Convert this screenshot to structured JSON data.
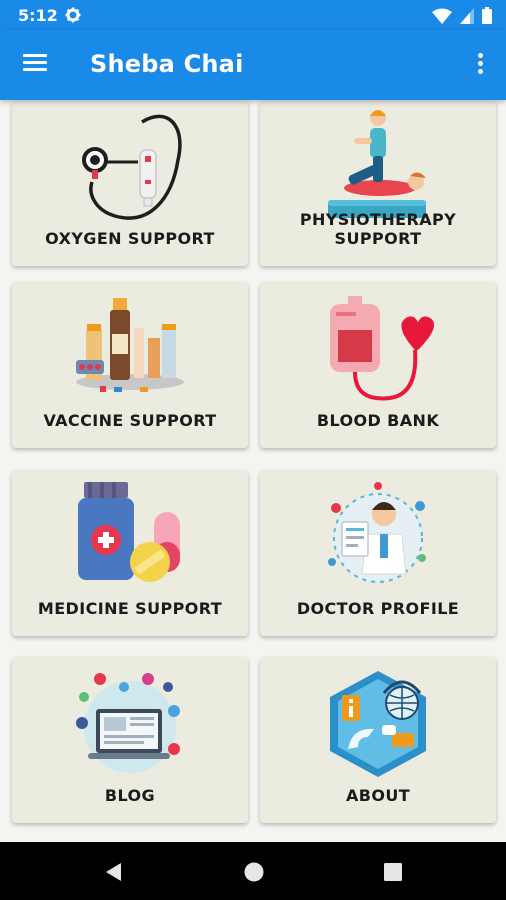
{
  "status_bar": {
    "time": "5:12",
    "icons": [
      "settings-gear-icon",
      "wifi-icon",
      "cellular-signal-icon",
      "battery-icon"
    ]
  },
  "app_bar": {
    "title": "Sheba Chai",
    "icons": [
      "hamburger-menu-icon",
      "more-vertical-icon"
    ],
    "color": "#1a8ae8"
  },
  "grid": {
    "cards": [
      {
        "label": "OXYGEN SUPPORT",
        "icon": "oxygen-mask-icon"
      },
      {
        "label": "PHYSIOTHERAPY SUPPORT",
        "icon": "physiotherapy-icon"
      },
      {
        "label": "VACCINE SUPPORT",
        "icon": "vaccine-bottles-icon"
      },
      {
        "label": "BLOOD BANK",
        "icon": "blood-bag-icon"
      },
      {
        "label": "MEDICINE SUPPORT",
        "icon": "medicine-bottle-pill-icon"
      },
      {
        "label": "DOCTOR PROFILE",
        "icon": "doctor-icon"
      },
      {
        "label": "BLOG",
        "icon": "blog-laptop-icon"
      },
      {
        "label": "ABOUT",
        "icon": "about-info-icon"
      }
    ]
  },
  "nav_bar": {
    "icons": [
      "back-icon",
      "home-icon",
      "recent-apps-icon"
    ]
  }
}
